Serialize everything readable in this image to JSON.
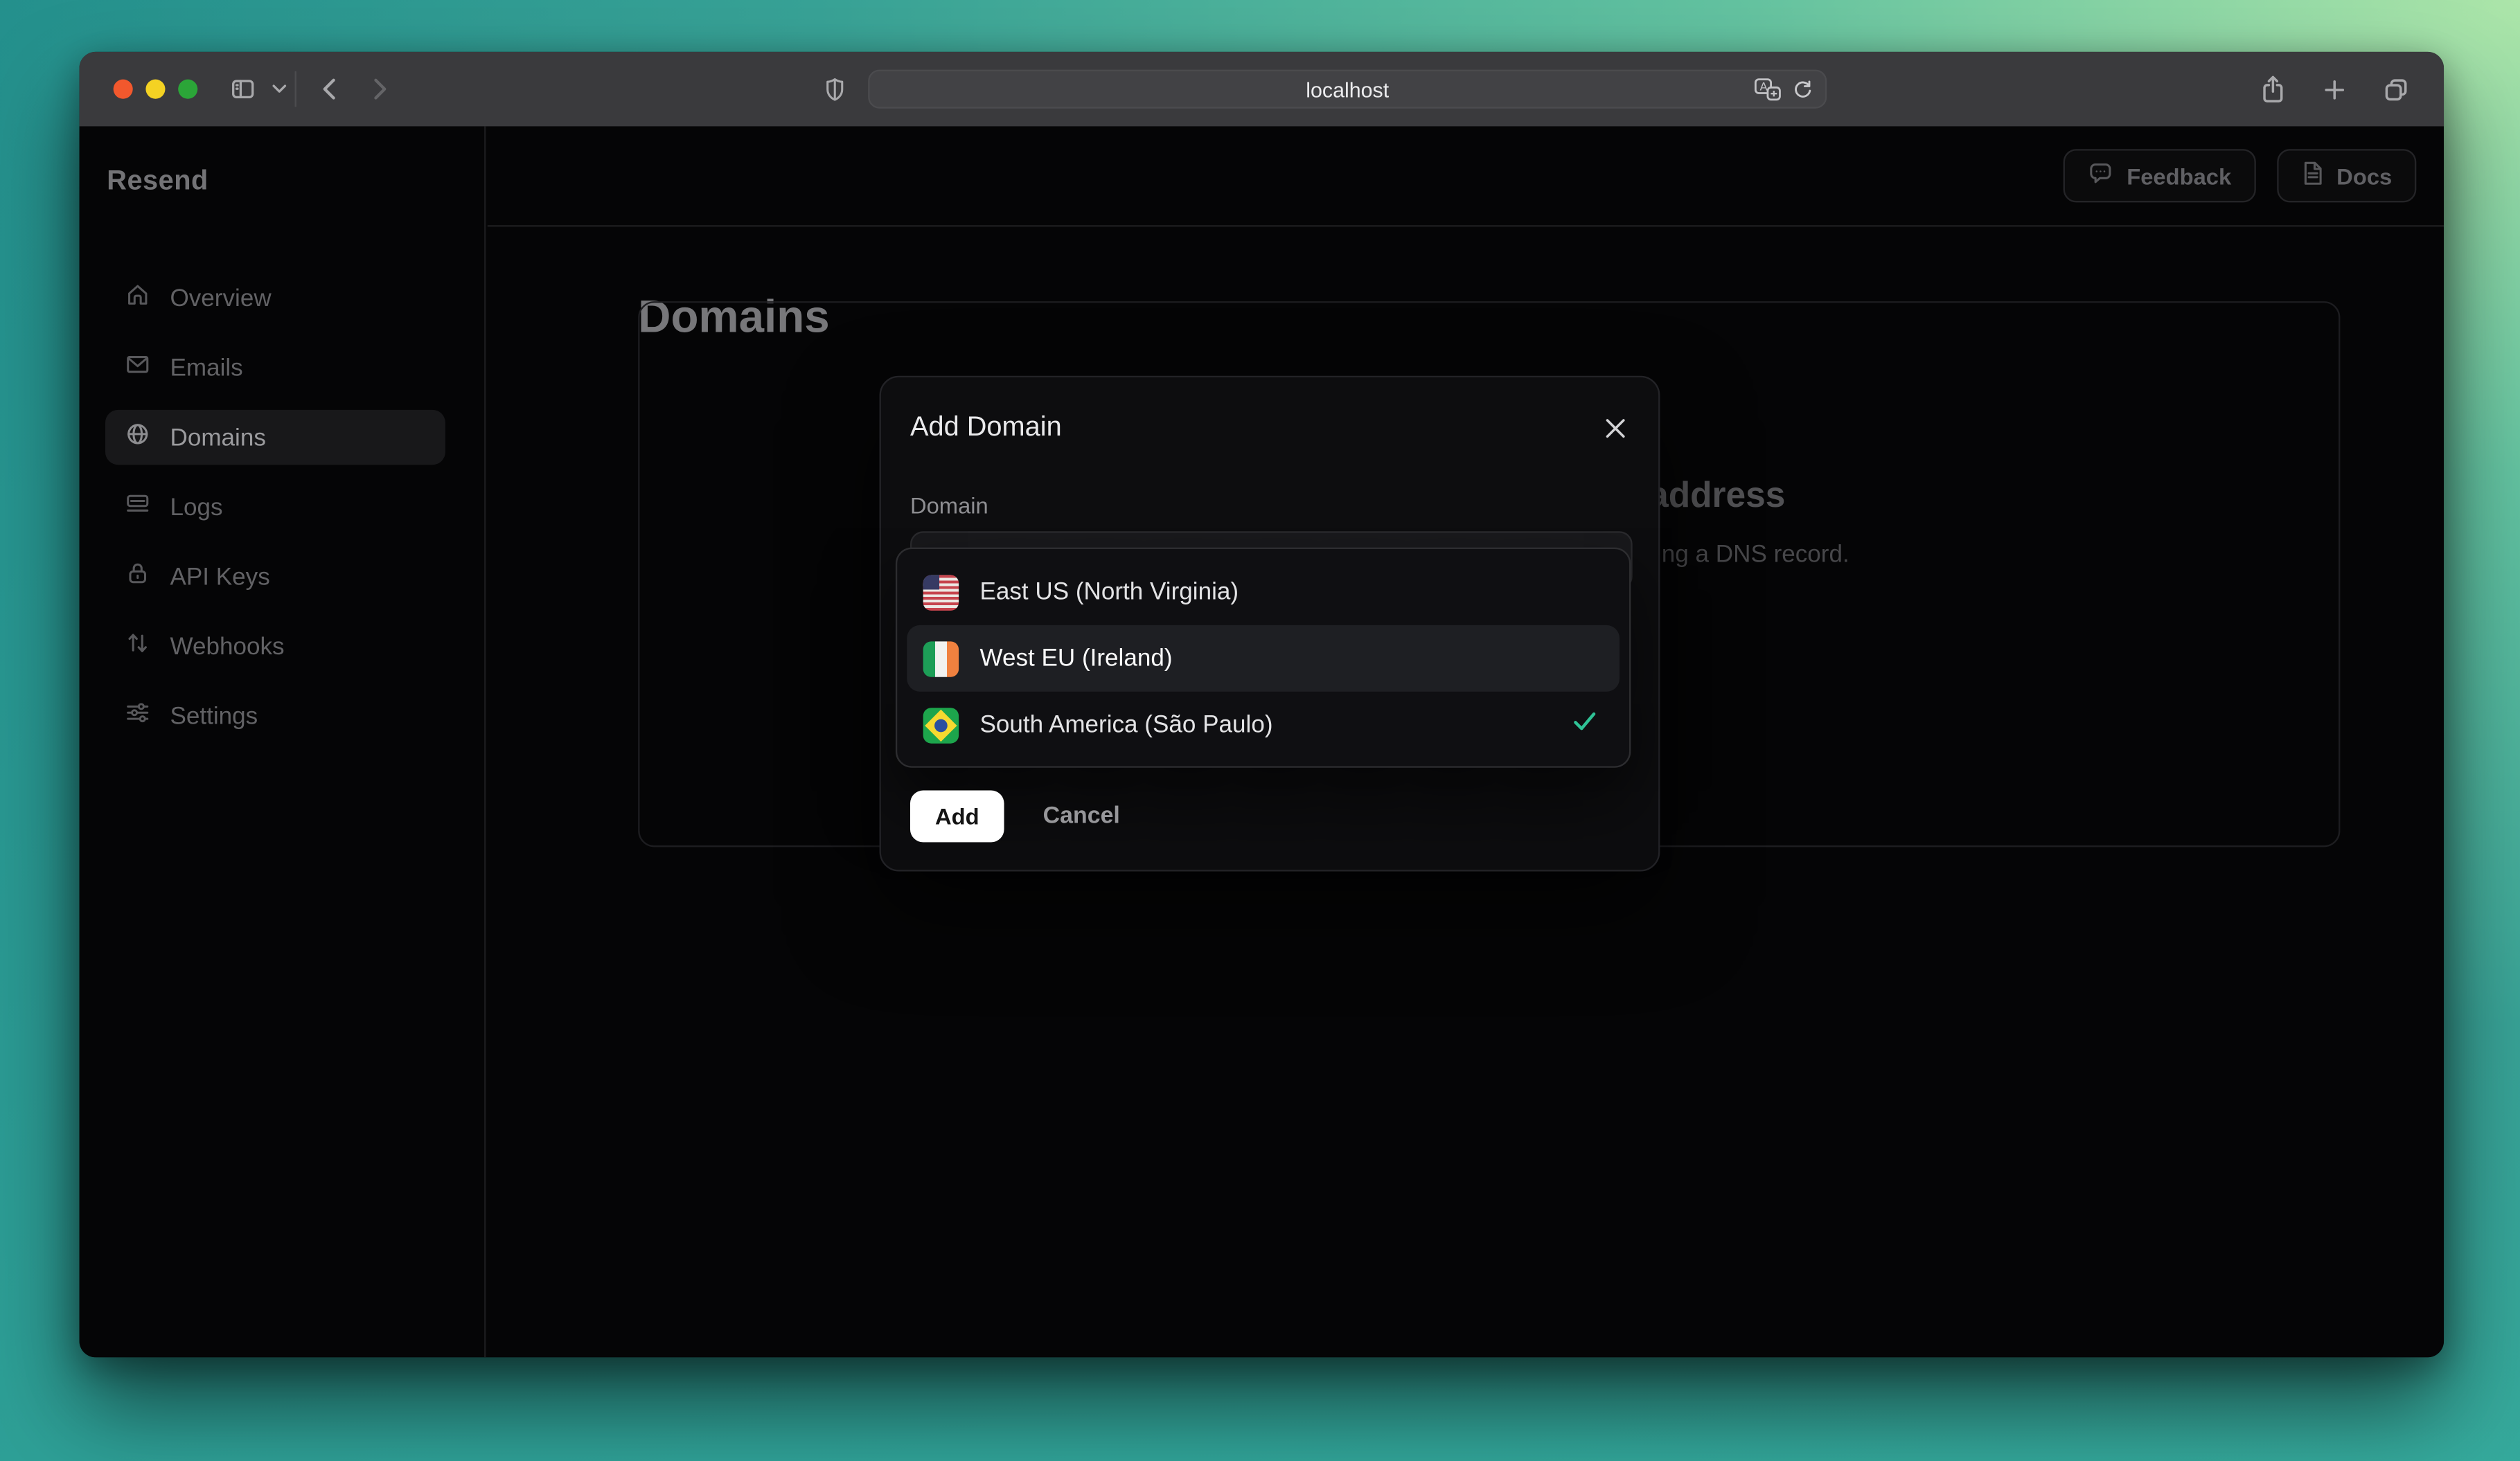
{
  "browser": {
    "url": "localhost",
    "traffic_lights": [
      "close",
      "minimize",
      "zoom"
    ]
  },
  "sidebar": {
    "logo": "Resend",
    "items": [
      {
        "label": "Overview",
        "icon": "home-icon"
      },
      {
        "label": "Emails",
        "icon": "envelope-icon"
      },
      {
        "label": "Domains",
        "icon": "globe-icon",
        "active": true
      },
      {
        "label": "Logs",
        "icon": "logs-icon"
      },
      {
        "label": "API Keys",
        "icon": "lock-icon"
      },
      {
        "label": "Webhooks",
        "icon": "arrows-up-down-icon"
      },
      {
        "label": "Settings",
        "icon": "sliders-icon"
      }
    ]
  },
  "header": {
    "feedback_label": "Feedback",
    "docs_label": "Docs"
  },
  "page": {
    "title": "Domains"
  },
  "empty_state": {
    "heading_visible_fragment": "address",
    "body_visible_fragment": "ng a DNS record."
  },
  "modal": {
    "title": "Add Domain",
    "field_label": "Domain",
    "input_value": "",
    "options": [
      {
        "label": "East US (North Virginia)",
        "flag": "us-flag",
        "highlighted": false,
        "selected": false
      },
      {
        "label": "West EU (Ireland)",
        "flag": "ireland-flag",
        "highlighted": true,
        "selected": false
      },
      {
        "label": "South America (São Paulo)",
        "flag": "brazil-flag",
        "highlighted": false,
        "selected": true
      }
    ],
    "add_label": "Add",
    "cancel_label": "Cancel"
  },
  "colors": {
    "check_accent": "#2fc296",
    "background_teal": "#27928e",
    "background_green": "#ace5a9",
    "modal_bg": "#0d0d0f",
    "chrome_bg": "#3a3a3d"
  }
}
